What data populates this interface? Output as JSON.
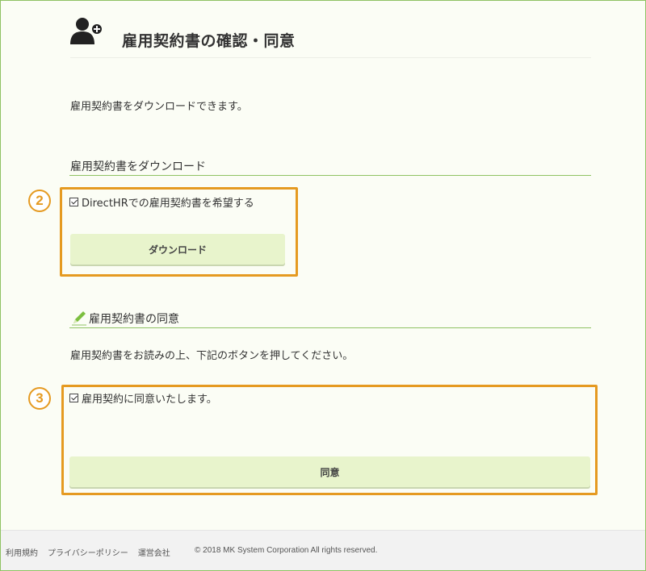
{
  "header": {
    "icon": "user-add-icon",
    "title": "雇用契約書の確認・同意"
  },
  "intro_text": "雇用契約書をダウンロードできます。",
  "download_section": {
    "heading": "雇用契約書をダウンロード",
    "step_number": "2",
    "checkbox_label": "DirectHRでの雇用契約書を希望する",
    "checkbox_checked": true,
    "button_label": "ダウンロード"
  },
  "agree_section": {
    "heading_icon": "pencil-icon",
    "heading": "雇用契約書の同意",
    "instruction": "雇用契約書をお読みの上、下記のボタンを押してください。",
    "step_number": "3",
    "checkbox_label": "雇用契約に同意いたします。",
    "checkbox_checked": true,
    "button_label": "同意"
  },
  "footer": {
    "links": [
      "利用規約",
      "プライバシーポリシー",
      "運営会社"
    ],
    "copyright": "© 2018 MK System Corporation All rights reserved."
  },
  "colors": {
    "accent_green": "#8fc262",
    "button_bg": "#e8f4cc",
    "highlight_orange": "#e59a21",
    "page_bg": "#fbfdf5"
  }
}
